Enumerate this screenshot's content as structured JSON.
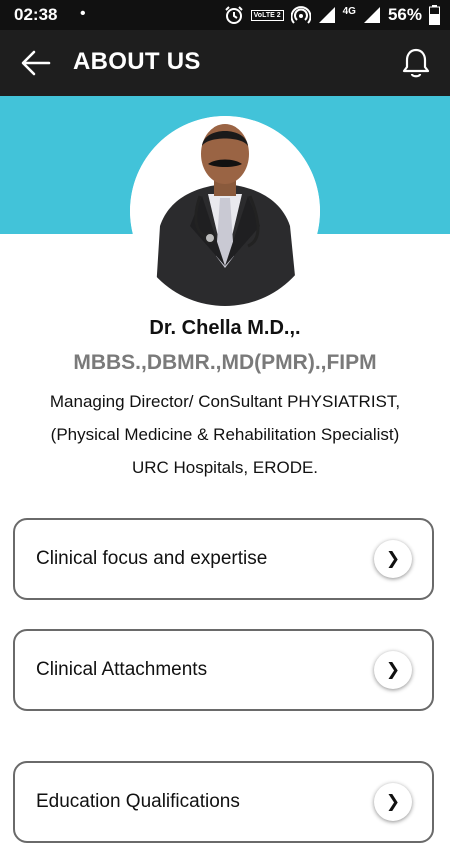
{
  "status_bar": {
    "time": "02:38",
    "notification_dot": "•",
    "volte_label": "VoLTE 2",
    "network_label": "4G",
    "battery_percent": "56%"
  },
  "app_bar": {
    "title": "ABOUT US"
  },
  "profile": {
    "name": "Dr. Chella M.D.,.",
    "degrees": "MBBS.,DBMR.,MD(PMR).,FIPM",
    "role_line1": "Managing Director/ ConSultant PHYSIATRIST,",
    "role_line2": "(Physical Medicine & Rehabilitation Specialist)",
    "role_line3": "URC Hospitals, ERODE."
  },
  "sections": [
    {
      "label": "Clinical focus and expertise",
      "chevron": "❯"
    },
    {
      "label": "Clinical Attachments",
      "chevron": "❯"
    },
    {
      "label": "Education Qualifications",
      "chevron": "❯"
    }
  ],
  "colors": {
    "status_bar_bg": "#111111",
    "app_bar_bg": "#1e1e1e",
    "banner_bg": "#42c3d9",
    "degrees_text": "#7a7a7a",
    "card_border": "#6a6a6a"
  },
  "icons": {
    "back": "arrow-left-icon",
    "notifications": "bell-icon",
    "alarm": "alarm-clock-icon",
    "hotspot": "hotspot-icon",
    "signal": "signal-icon",
    "battery": "battery-icon",
    "card_chevron": "chevron-right-icon"
  }
}
